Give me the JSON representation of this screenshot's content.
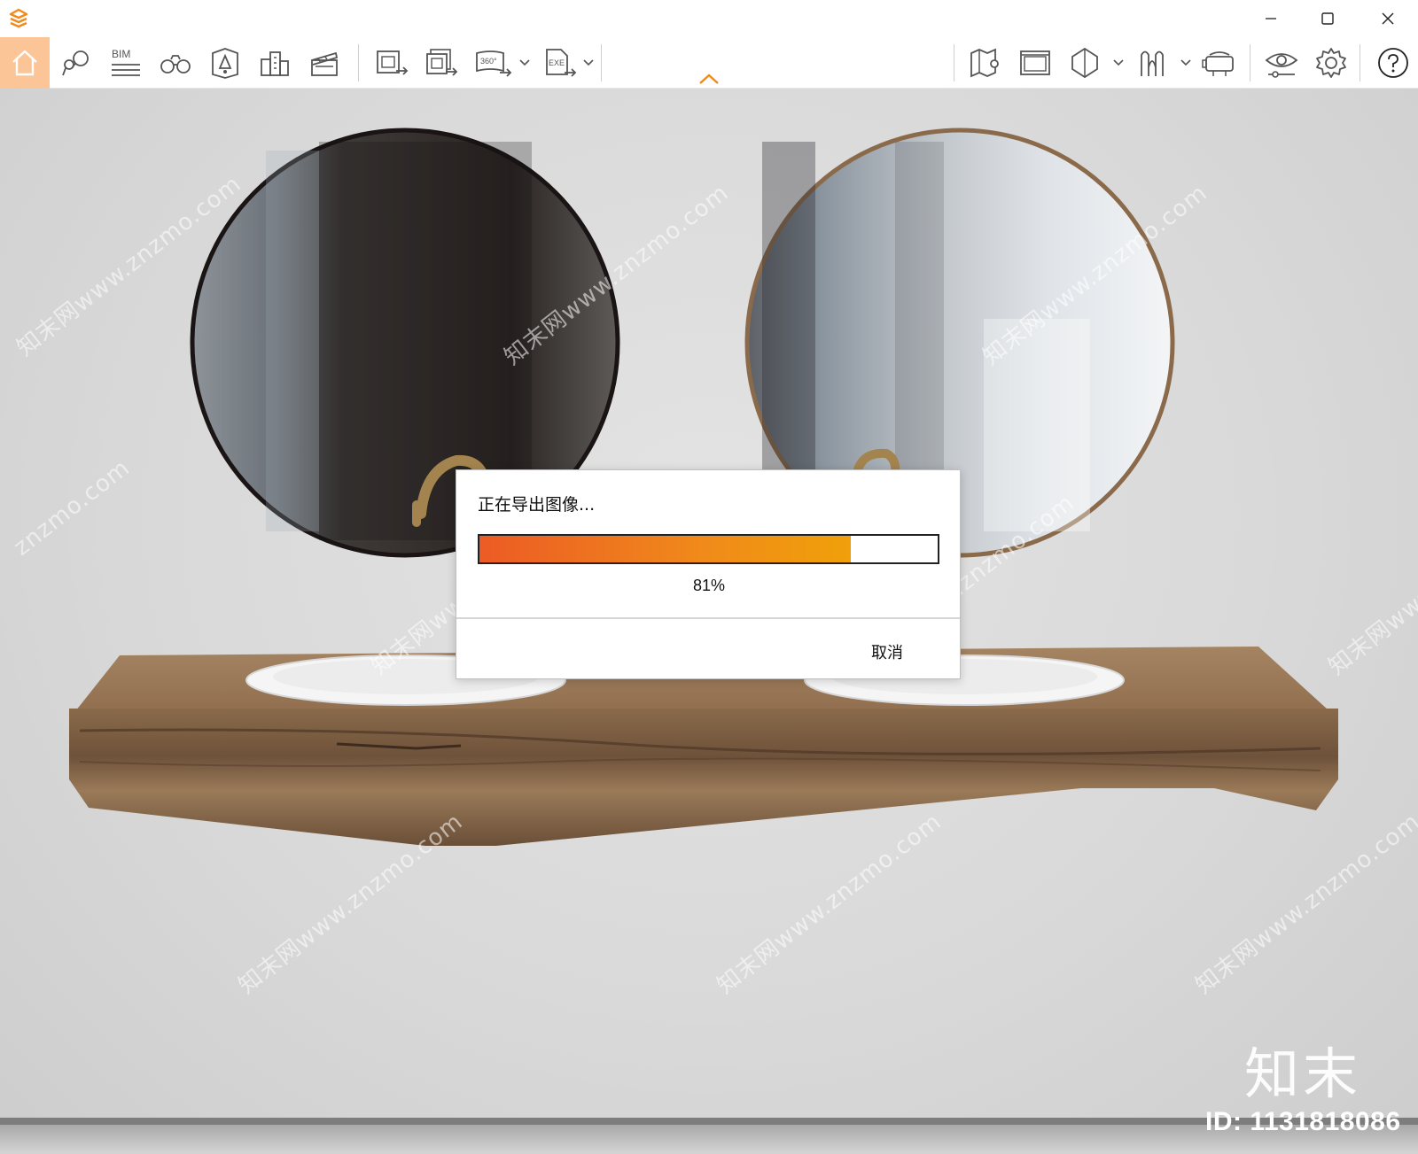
{
  "titlebar": {
    "logo_icon": "enscape-logo-icon",
    "accent": "#f08a1a",
    "controls": [
      "minimize-icon",
      "maximize-icon",
      "close-icon"
    ]
  },
  "toolbar": {
    "bim_label": "BIM",
    "panorama_label": "360°",
    "exe_label": "EXE",
    "home_highlight": "#fbc597",
    "left_tools": [
      "home-icon",
      "asset-library-icon",
      "bim-icon",
      "binoculars-icon",
      "light-view-icon",
      "buildings-icon",
      "clapper-icon"
    ],
    "export_tools": [
      "export-image-icon",
      "export-batch-icon",
      "export-panorama-icon",
      "export-exe-icon"
    ],
    "right_tools": [
      "map-icon",
      "views-icon",
      "section-icon",
      "material-icon",
      "vr-headset-icon",
      "visual-settings-icon",
      "settings-icon",
      "help-icon"
    ]
  },
  "viewport": {
    "watermarks": [
      "知末网www.znzmo.com",
      "知末网www.znzmo.com",
      "知末网www.znzmo.com",
      "znzmo.com",
      "知末网www.znzmo.com",
      "知末网www.znzmo.com",
      "知末网www.znzmo.com",
      "知末网www.znzmo.com",
      "知末网www.znzmo.com",
      "知末网www.znzmo.com"
    ],
    "brand": "知末",
    "brand_id": "ID: 1131818086"
  },
  "dialog": {
    "title": "正在导出图像...",
    "progress_percent": 81,
    "progress_label": "81%",
    "cancel_label": "取消"
  }
}
